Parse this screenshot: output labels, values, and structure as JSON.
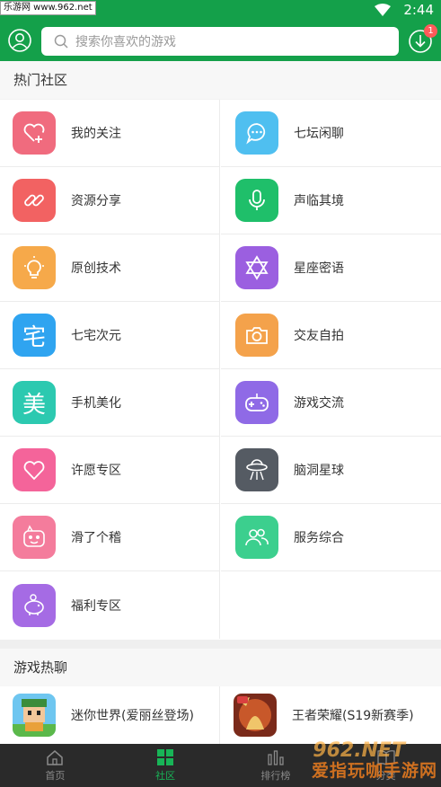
{
  "status": {
    "watermark": "乐游网 www.962.net",
    "time": "2:44"
  },
  "header": {
    "search_placeholder": "搜索你喜欢的游戏",
    "download_badge": "1"
  },
  "hot_section": {
    "title": "热门社区",
    "items": [
      {
        "label": "我的关注",
        "icon": "heart-plus-icon",
        "color": "#f06b7e"
      },
      {
        "label": "七坛闲聊",
        "icon": "chat-bubble-icon",
        "color": "#4fbff0"
      },
      {
        "label": "资源分享",
        "icon": "link-icon",
        "color": "#f26262"
      },
      {
        "label": "声临其境",
        "icon": "microphone-icon",
        "color": "#1fbf6a"
      },
      {
        "label": "原创技术",
        "icon": "lightbulb-icon",
        "color": "#f6a94a"
      },
      {
        "label": "星座密语",
        "icon": "star-of-david-icon",
        "color": "#9b5fe0"
      },
      {
        "label": "七宅次元",
        "icon": "zhai-character-icon",
        "color": "#2fa4f0"
      },
      {
        "label": "交友自拍",
        "icon": "camera-icon",
        "color": "#f4a24b"
      },
      {
        "label": "手机美化",
        "icon": "mei-character-icon",
        "color": "#2cc9b0"
      },
      {
        "label": "游戏交流",
        "icon": "gamepad-icon",
        "color": "#8f6ae6"
      },
      {
        "label": "许愿专区",
        "icon": "heart-icon",
        "color": "#f4649a"
      },
      {
        "label": "脑洞星球",
        "icon": "ufo-icon",
        "color": "#555b63"
      },
      {
        "label": "滑了个稽",
        "icon": "funny-face-icon",
        "color": "#f47c9c"
      },
      {
        "label": "服务综合",
        "icon": "users-icon",
        "color": "#3ccf8e"
      },
      {
        "label": "福利专区",
        "icon": "piggy-bank-icon",
        "color": "#a56be4"
      }
    ]
  },
  "game_section": {
    "title": "游戏热聊",
    "items": [
      {
        "label": "迷你世界(爱丽丝登场)",
        "icon": "mini-world-game-icon"
      },
      {
        "label": "王者荣耀(S19新赛季)",
        "icon": "honor-of-kings-game-icon"
      }
    ]
  },
  "tabs": [
    {
      "label": "首页",
      "icon": "home-icon",
      "active": false
    },
    {
      "label": "社区",
      "icon": "grid-icon",
      "active": true
    },
    {
      "label": "排行榜",
      "icon": "bar-chart-icon",
      "active": false
    },
    {
      "label": "分类",
      "icon": "book-icon",
      "active": false
    }
  ],
  "watermark_bottom": "962.NET",
  "watermark_bottom_cn": "爱指玩咖手游网"
}
